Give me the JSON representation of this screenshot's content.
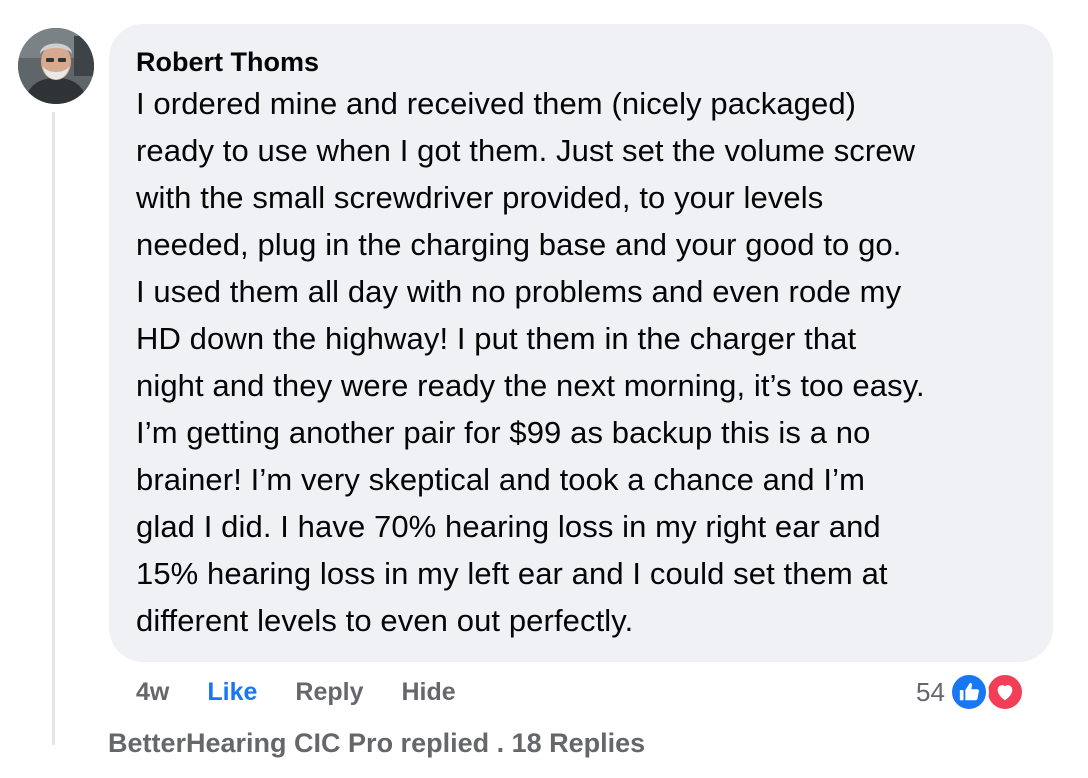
{
  "comment": {
    "author": "Robert Thoms",
    "text": "I ordered mine and received them (nicely packaged)\nready to use when I got them. Just set the volume screw\nwith the small screwdriver provided, to your levels\nneeded, plug in the charging base and your good to go.\nI used them all day with no problems and even rode my\nHD down the highway! I put them in the charger that\nnight and they were ready the next morning, it’s too easy.\nI’m getting another pair for $99 as backup this is a no\nbrainer! I’m very skeptical and took a chance and I’m\nglad I did. I have 70% hearing loss in my right ear and\n15% hearing loss in my left ear and I could set them at\ndifferent levels to even out perfectly.",
    "avatar_icon": "profile-photo"
  },
  "actions": {
    "time": "4w",
    "like": "Like",
    "reply": "Reply",
    "hide": "Hide"
  },
  "reactions": {
    "count": "54",
    "icons": [
      "thumbs-up-icon",
      "heart-icon"
    ]
  },
  "replies_text": "BetterHearing CIC Pro replied . 18 Replies",
  "colors": {
    "bubble": "#eff1f4",
    "like_blue": "#1877f2",
    "love_red": "#f33e58",
    "muted": "#65676b"
  }
}
